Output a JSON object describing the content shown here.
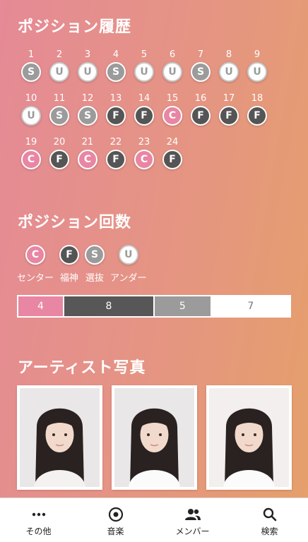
{
  "history": {
    "title": "ポジション履歴",
    "rows": [
      [
        {
          "n": "1",
          "p": "S"
        },
        {
          "n": "2",
          "p": "U"
        },
        {
          "n": "3",
          "p": "U"
        },
        {
          "n": "4",
          "p": "S"
        },
        {
          "n": "5",
          "p": "U"
        },
        {
          "n": "6",
          "p": "U"
        },
        {
          "n": "7",
          "p": "S"
        },
        {
          "n": "8",
          "p": "U"
        },
        {
          "n": "9",
          "p": "U"
        }
      ],
      [
        {
          "n": "10",
          "p": "U"
        },
        {
          "n": "11",
          "p": "S"
        },
        {
          "n": "12",
          "p": "S"
        },
        {
          "n": "13",
          "p": "F"
        },
        {
          "n": "14",
          "p": "F"
        },
        {
          "n": "15",
          "p": "C"
        },
        {
          "n": "16",
          "p": "F"
        },
        {
          "n": "17",
          "p": "F"
        },
        {
          "n": "18",
          "p": "F"
        }
      ],
      [
        {
          "n": "19",
          "p": "C"
        },
        {
          "n": "20",
          "p": "F"
        },
        {
          "n": "21",
          "p": "C"
        },
        {
          "n": "22",
          "p": "F"
        },
        {
          "n": "23",
          "p": "C"
        },
        {
          "n": "24",
          "p": "F"
        }
      ]
    ]
  },
  "counts": {
    "title": "ポジション回数",
    "legend": [
      {
        "letter": "C",
        "label": "センター"
      },
      {
        "letter": "F",
        "label": "福神"
      },
      {
        "letter": "S",
        "label": "選抜"
      },
      {
        "letter": "U",
        "label": "アンダー"
      }
    ],
    "bar": [
      {
        "p": "C",
        "value": "4"
      },
      {
        "p": "F",
        "value": "8"
      },
      {
        "p": "S",
        "value": "5"
      },
      {
        "p": "U",
        "value": "7"
      }
    ]
  },
  "photos": {
    "title": "アーティスト写真",
    "count": 3
  },
  "tabbar": {
    "tabs": [
      {
        "label": "その他",
        "icon": "more-icon"
      },
      {
        "label": "音楽",
        "icon": "music-icon"
      },
      {
        "label": "メンバー",
        "icon": "members-icon"
      },
      {
        "label": "検索",
        "icon": "search-icon"
      }
    ]
  },
  "colors": {
    "center": "#e886a3",
    "fukujin": "#555555",
    "senbatsu": "#9b9b9b",
    "under": "#ffffff"
  }
}
